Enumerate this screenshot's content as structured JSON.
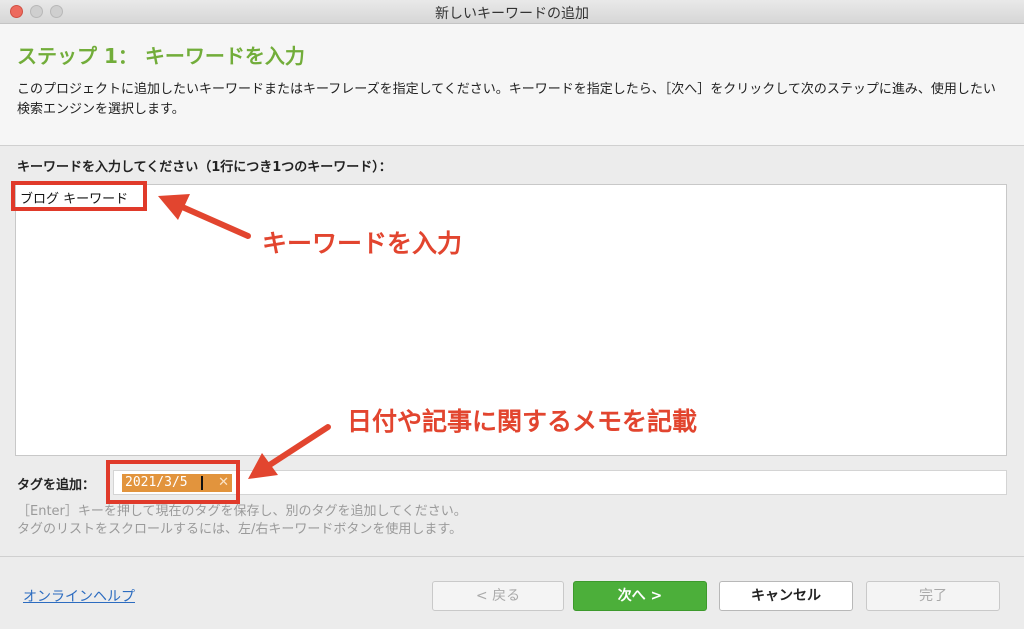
{
  "window": {
    "title": "新しいキーワードの追加"
  },
  "header": {
    "step_title": "ステップ 1： キーワードを入力",
    "description": "このプロジェクトに追加したいキーワードまたはキーフレーズを指定してください。キーワードを指定したら、［次へ］をクリックして次のステップに進み、使用したい検索エンジンを選択します。"
  },
  "keywords": {
    "label": "キーワードを入力してください（1行につき1つのキーワード）：",
    "value": "ブログ キーワード"
  },
  "annotations": {
    "keyword_note": "キーワードを入力",
    "tag_note": "日付や記事に関するメモを記載",
    "color": "#e2452f"
  },
  "tags": {
    "label": "タグを追加：",
    "chip_value": "2021/3/5",
    "chip_remove_icon": "close-icon",
    "hint_line1": "［Enter］キーを押して現在のタグを保存し、別のタグを追加してください。",
    "hint_line2": "タグのリストをスクロールするには、左/右キーワードボタンを使用します。"
  },
  "footer": {
    "help_link": "オンラインヘルプ",
    "back_label": "< 戻る",
    "next_label": "次へ >",
    "cancel_label": "キャンセル",
    "finish_label": "完了"
  },
  "colors": {
    "accent_green": "#72ad3a",
    "next_button": "#4caf3a",
    "tag_chip": "#e2943d",
    "highlight": "#e03a2a"
  }
}
